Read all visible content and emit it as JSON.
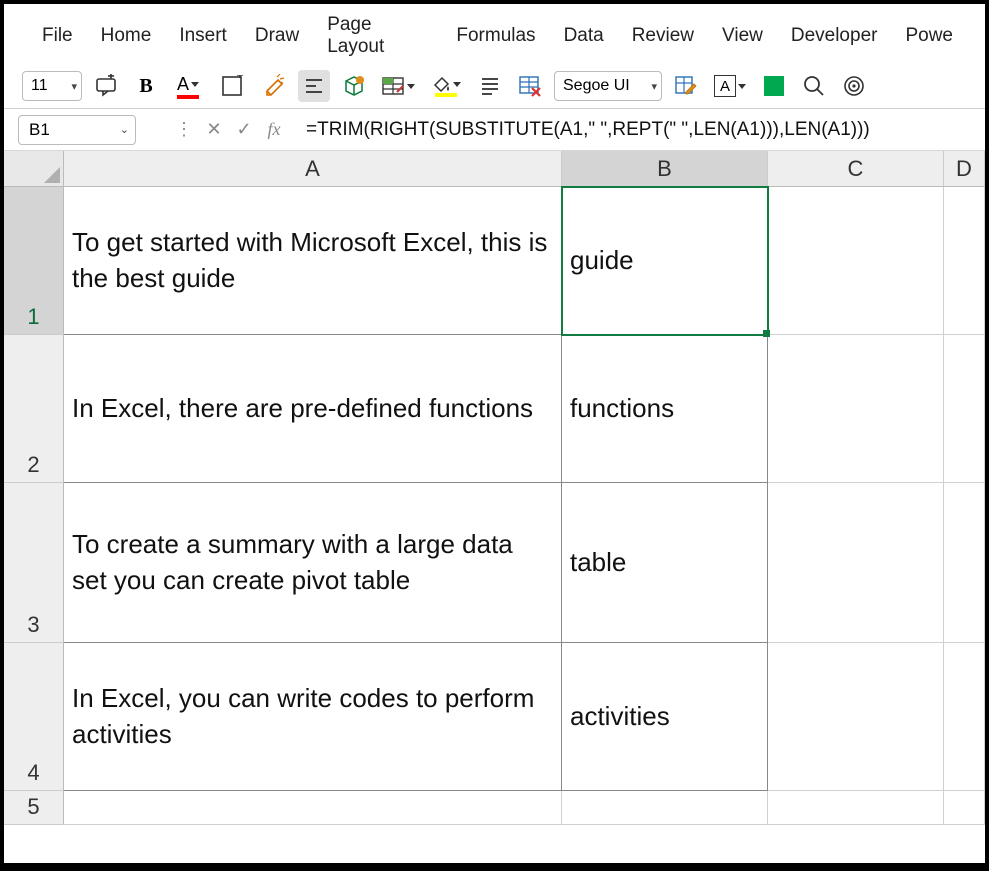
{
  "menubar": {
    "file": "File",
    "home": "Home",
    "insert": "Insert",
    "draw": "Draw",
    "page_layout": "Page Layout",
    "formulas": "Formulas",
    "data": "Data",
    "review": "Review",
    "view": "View",
    "developer": "Developer",
    "power": "Powe"
  },
  "toolbar": {
    "font_size": "11",
    "bold": "B",
    "font_color_letter": "A",
    "font_name": "Segoe UI",
    "a_box": "A"
  },
  "colors": {
    "font_color_underline": "#ff0000",
    "fill_color_underline": "#ffff00",
    "green_square": "#00a84f",
    "excel_green": "#107c41"
  },
  "formula_bar": {
    "name_box": "B1",
    "colon": "⋮",
    "cancel": "✕",
    "enter": "✓",
    "fx": "fx",
    "formula": "=TRIM(RIGHT(SUBSTITUTE(A1,\" \",REPT(\" \",LEN(A1))),LEN(A1)))"
  },
  "sheet": {
    "columns": [
      "A",
      "B",
      "C",
      "D"
    ],
    "selected_column": "B",
    "selected_row": "1",
    "rows": [
      {
        "num": "1",
        "A": "To get started with Microsoft Excel, this is the best guide",
        "B": "guide"
      },
      {
        "num": "2",
        "A": "In Excel, there are pre-defined functions",
        "B": "functions"
      },
      {
        "num": "3",
        "A": "To create a summary with a large data set you can create pivot table",
        "B": "table"
      },
      {
        "num": "4",
        "A": "In Excel, you can write codes to perform activities",
        "B": "activities"
      },
      {
        "num": "5",
        "A": "",
        "B": ""
      }
    ]
  }
}
